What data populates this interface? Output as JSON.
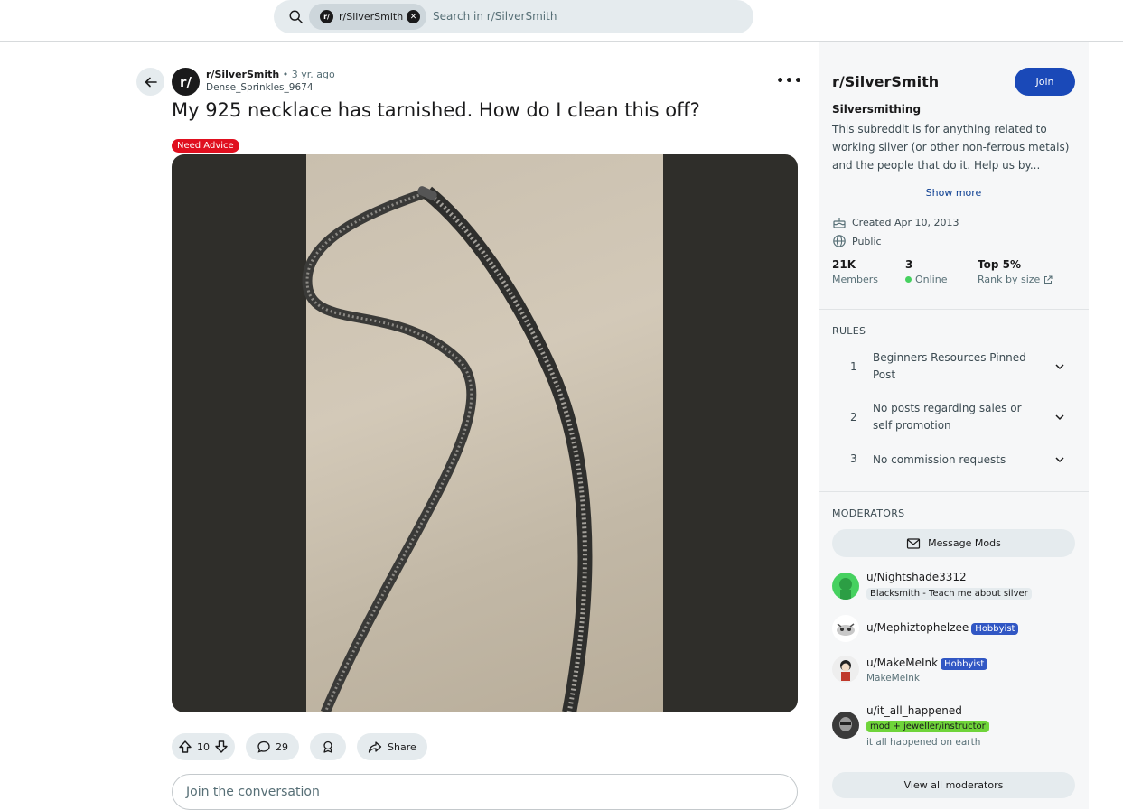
{
  "search": {
    "chip_label": "r/SilverSmith",
    "chip_icon": "r/",
    "placeholder": "Search in r/SilverSmith"
  },
  "post": {
    "subreddit_icon": "r/",
    "subreddit": "r/SilverSmith",
    "separator": "•",
    "age": "3 yr. ago",
    "author": "Dense_Sprinkles_9674",
    "more": "•••",
    "title": "My 925 necklace has tarnished. How do I clean this off?",
    "flair": "Need Advice",
    "flair_color": "#e00f1f",
    "image_icon": "photo-necklace",
    "upvotes": "10",
    "comments": "29",
    "share_label": "Share",
    "comment_placeholder": "Join the conversation"
  },
  "sidebar": {
    "title": "r/SilverSmith",
    "join_label": "Join",
    "join_color": "#1a49b8",
    "subtitle": "Silversmithing",
    "description": "This subreddit is for anything related to working silver (or other non-ferrous metals) and the people that do it. Help us by...",
    "show_more": "Show more",
    "created": "Created Apr 10, 2013",
    "visibility": "Public",
    "stats": [
      {
        "value": "21K",
        "label": "Members"
      },
      {
        "value": "3",
        "label": "Online"
      },
      {
        "value": "Top 5%",
        "label": "Rank by size"
      }
    ],
    "rules_heading": "RULES",
    "rules": [
      {
        "num": "1",
        "text": "Beginners Resources Pinned Post"
      },
      {
        "num": "2",
        "text": "No posts regarding sales or self promotion"
      },
      {
        "num": "3",
        "text": "No commission requests"
      }
    ],
    "moderators_heading": "MODERATORS",
    "message_mods": "Message Mods",
    "moderators": [
      {
        "name": "u/Nightshade3312",
        "flair": "Blacksmith - Teach me about silver",
        "flair_bg": "#e5ebee",
        "flair_fg": "#1a1a1b",
        "sub": ""
      },
      {
        "name": "u/Mephiztophelzee",
        "flair": "Hobbyist",
        "flair_bg": "#3157c4",
        "flair_fg": "#ffffff",
        "sub": ""
      },
      {
        "name": "u/MakeMeInk",
        "flair": "Hobbyist",
        "flair_bg": "#3157c4",
        "flair_fg": "#ffffff",
        "sub": "MakeMeInk"
      },
      {
        "name": "u/it_all_happened",
        "flair": "mod + jeweller/instructor",
        "flair_bg": "#6fd43a",
        "flair_fg": "#1a1a1b",
        "sub": "it all happened on earth"
      }
    ],
    "view_all": "View all moderators"
  }
}
